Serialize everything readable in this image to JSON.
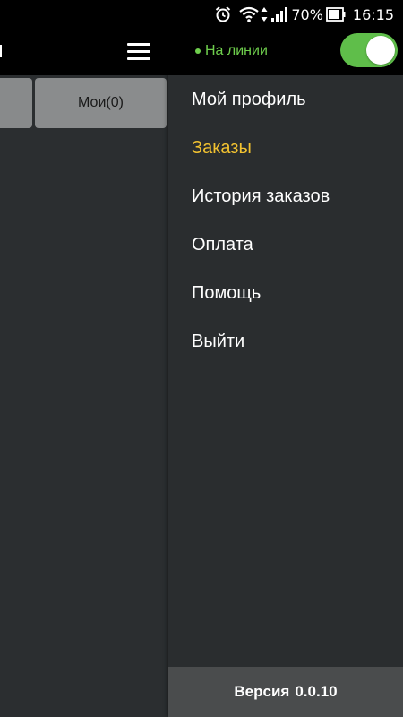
{
  "status_bar": {
    "icons": [
      "alarm-icon",
      "wifi-icon",
      "data-arrows-icon",
      "signal-icon"
    ],
    "battery_percent": "70%",
    "time": "16:15"
  },
  "main": {
    "tabs": [
      {
        "label": ""
      },
      {
        "label": "Мои(0)"
      }
    ]
  },
  "drawer": {
    "status_label": "На линии",
    "status_color": "#6fcf4d",
    "online_toggle_on": true,
    "menu": [
      {
        "label": "Мой профиль",
        "active": false
      },
      {
        "label": "Заказы",
        "active": true
      },
      {
        "label": "История заказов",
        "active": false
      },
      {
        "label": "Оплата",
        "active": false
      },
      {
        "label": "Помощь",
        "active": false
      },
      {
        "label": "Выйти",
        "active": false
      }
    ],
    "active_color": "#f2c230",
    "version_label": "Версия",
    "version_number": "0.0.10"
  }
}
